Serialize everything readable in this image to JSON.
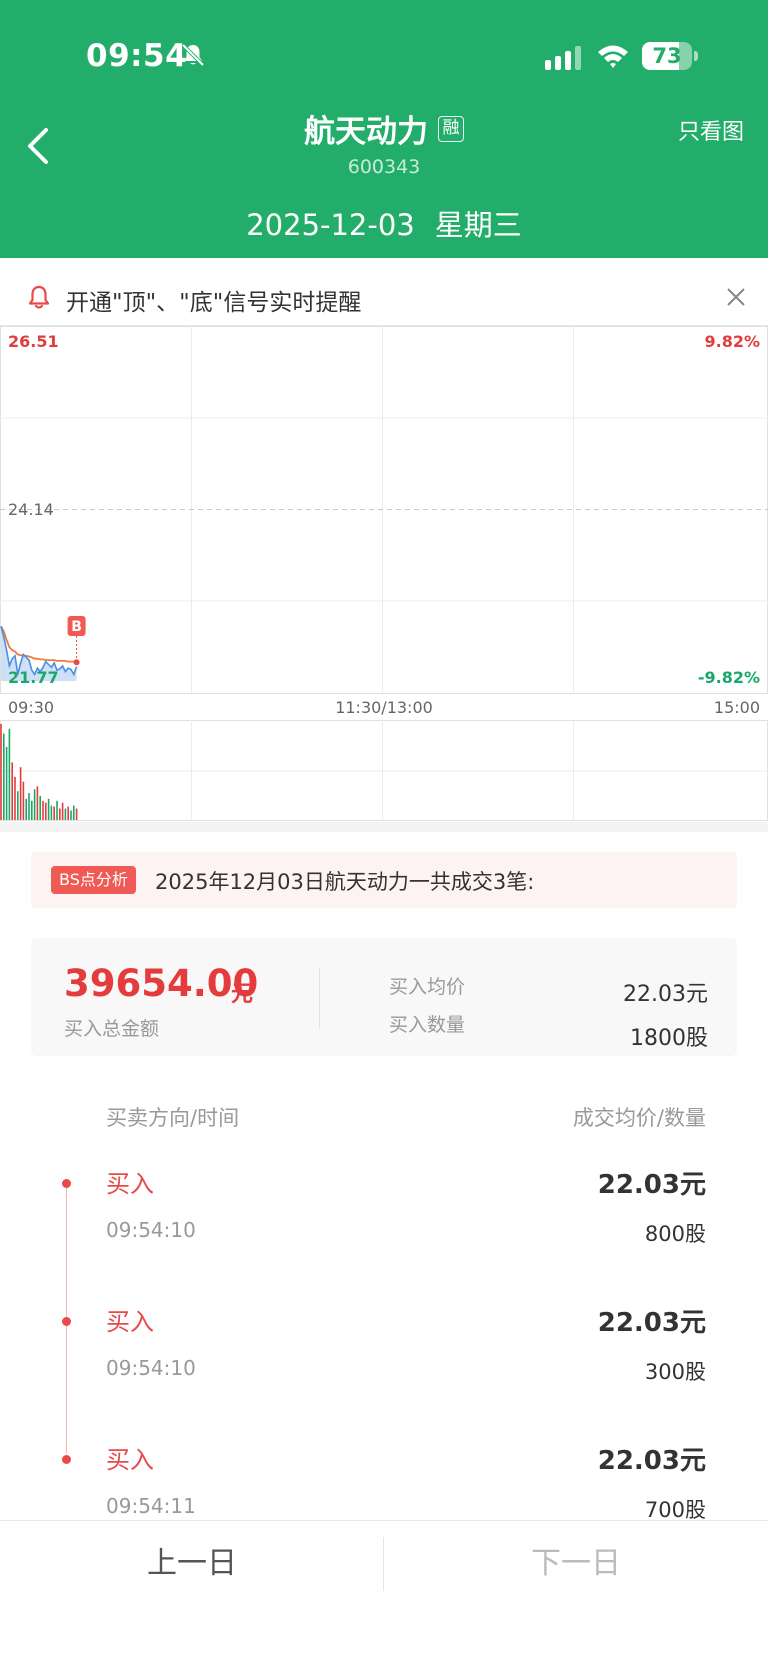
{
  "status_bar": {
    "time": "09:54",
    "battery": "73",
    "battery_level": 0.73
  },
  "header": {
    "title": "航天动力",
    "badge": "融",
    "code": "600343",
    "right_action": "只看图",
    "date": "2025-12-03",
    "weekday": "星期三"
  },
  "alert": {
    "text": "开通\"顶\"、\"底\"信号实时提醒"
  },
  "colors": {
    "header_green": "#23ad6a",
    "up_red": "#e43c3c",
    "down_green": "#1aa868",
    "price_line": "#4a8fe0",
    "avg_line": "#ef7a3c"
  },
  "chart_data": {
    "type": "line",
    "price_labels": {
      "high": "26.51",
      "mid": "24.14",
      "low": "21.77"
    },
    "pct_labels": {
      "high": "9.82%",
      "low": "-9.82%"
    },
    "ylim": [
      21.77,
      26.51
    ],
    "x_ticks": [
      "09:30",
      "11:30/13:00",
      "15:00"
    ],
    "series": [
      {
        "values": [
          22.53,
          22.38,
          22.2,
          21.98,
          22.08,
          22.12,
          21.86,
          22.02,
          22.14,
          22.1,
          22.06,
          21.92,
          21.86,
          21.95,
          21.9,
          21.96,
          22.04,
          22.0,
          21.96,
          22.02,
          21.92,
          21.94,
          21.98,
          21.9,
          21.95,
          21.93,
          21.86,
          21.97
        ]
      },
      {
        "values": [
          22.53,
          22.46,
          22.34,
          22.24,
          22.2,
          22.18,
          22.14,
          22.13,
          22.12,
          22.12,
          22.11,
          22.1,
          22.08,
          22.08,
          22.07,
          22.07,
          22.06,
          22.06,
          22.06,
          22.06,
          22.05,
          22.05,
          22.05,
          22.05,
          22.04,
          22.04,
          22.04,
          22.03
        ]
      }
    ],
    "volume": [
      100,
      90,
      76,
      95,
      60,
      45,
      30,
      55,
      40,
      22,
      28,
      20,
      32,
      35,
      25,
      20,
      18,
      22,
      15,
      14,
      20,
      12,
      18,
      12,
      14,
      10,
      15,
      12
    ],
    "marker": {
      "label": "B",
      "price": 22.03
    }
  },
  "bs": {
    "tag": "BS点分析",
    "text": "2025年12月03日航天动力一共成交3笔:"
  },
  "summary": {
    "amount": "39654.00",
    "unit": "元",
    "amount_label": "买入总金额",
    "avg_price_label": "买入均价",
    "avg_price": "22.03元",
    "qty_label": "买入数量",
    "qty": "1800股"
  },
  "trades_header": {
    "left": "买卖方向/时间",
    "right": "成交均价/数量"
  },
  "trades": [
    {
      "dir": "买入",
      "price": "22.03元",
      "time": "09:54:10",
      "qty": "800股"
    },
    {
      "dir": "买入",
      "price": "22.03元",
      "time": "09:54:10",
      "qty": "300股"
    },
    {
      "dir": "买入",
      "price": "22.03元",
      "time": "09:54:11",
      "qty": "700股"
    }
  ],
  "bottom_nav": {
    "prev": "上一日",
    "next": "下一日"
  }
}
